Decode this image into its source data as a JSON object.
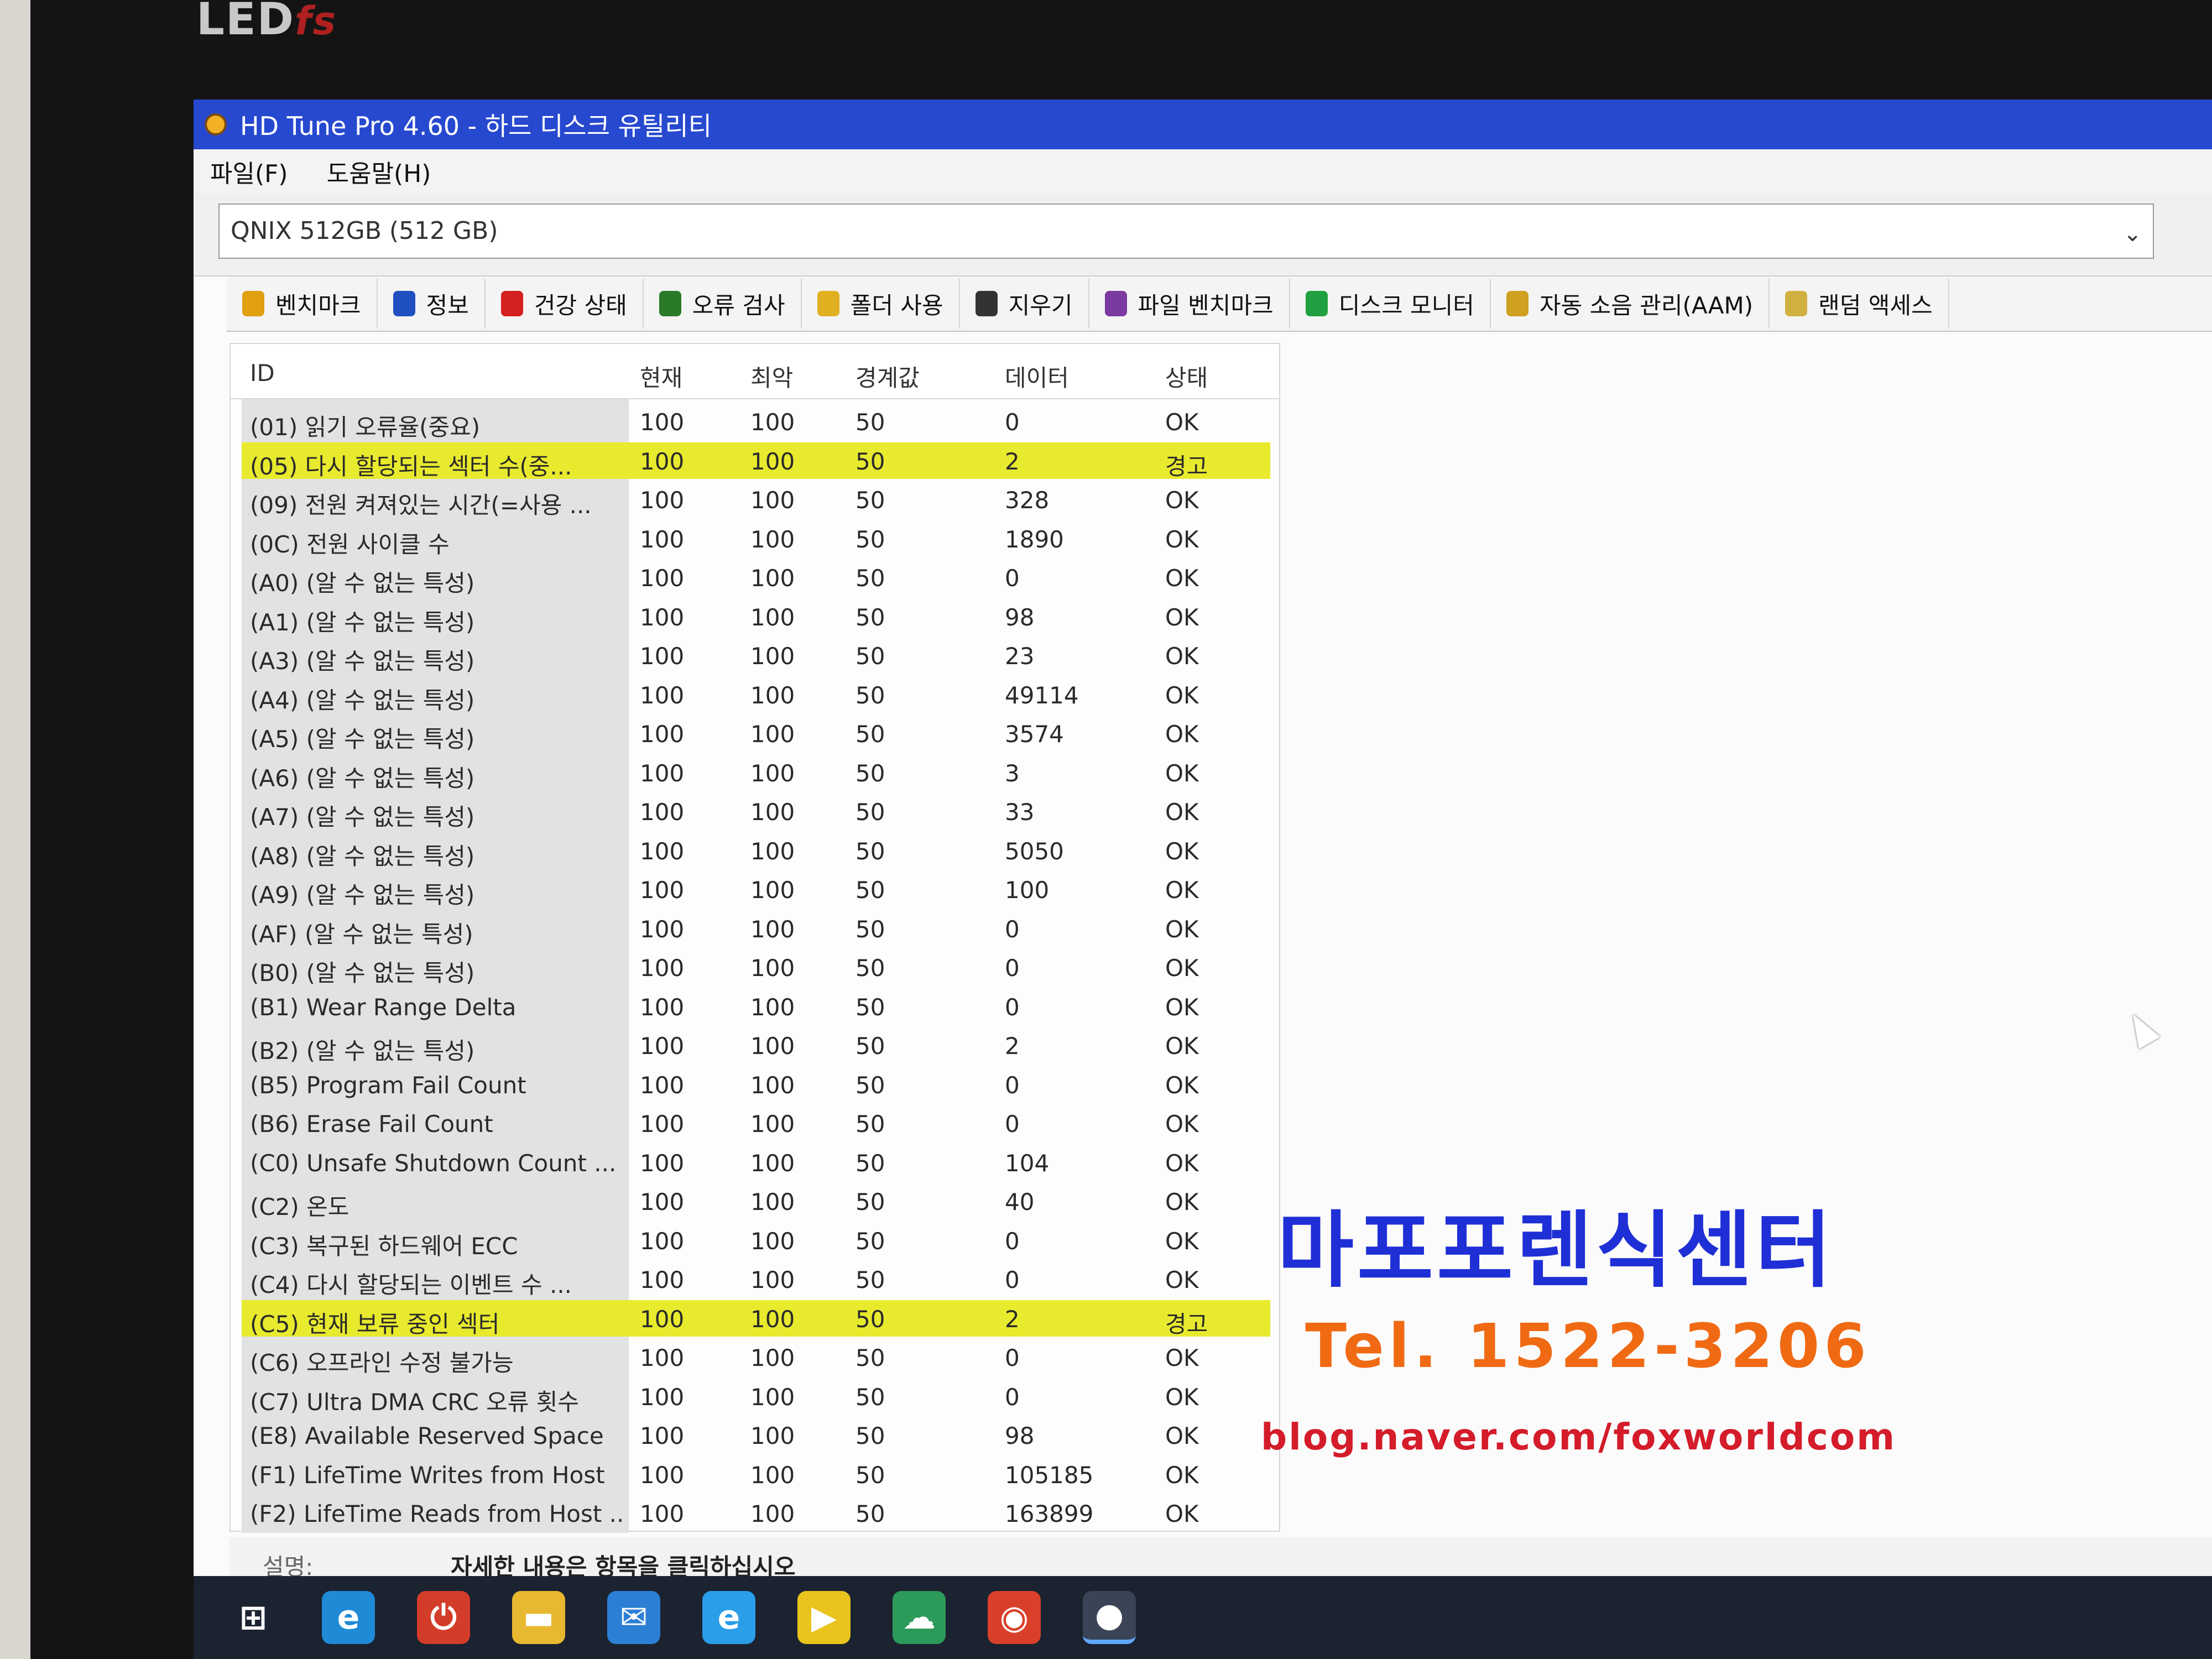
{
  "monitor": {
    "brand": "LED",
    "brand_suffix": "fs"
  },
  "window": {
    "title": "HD Tune Pro 4.60 - 하드 디스크 유틸리티"
  },
  "menu": {
    "file": "파일(F)",
    "help": "도움말(H)"
  },
  "drive": {
    "selected": "QNIX 512GB (512 GB)"
  },
  "tabs": [
    {
      "label": "벤치마크",
      "icon": "bulb-icon",
      "color": "#e0a010"
    },
    {
      "label": "정보",
      "icon": "info-icon",
      "color": "#2050c0"
    },
    {
      "label": "건강 상태",
      "icon": "health-cross-icon",
      "color": "#d42020"
    },
    {
      "label": "오류 검사",
      "icon": "magnifier-icon",
      "color": "#2a7a2a"
    },
    {
      "label": "폴더 사용",
      "icon": "folder-icon",
      "color": "#e0b020"
    },
    {
      "label": "지우기",
      "icon": "trash-icon",
      "color": "#333333"
    },
    {
      "label": "파일 벤치마크",
      "icon": "file-bench-icon",
      "color": "#7a3aa0"
    },
    {
      "label": "디스크 모니터",
      "icon": "monitor-chart-icon",
      "color": "#20a040"
    },
    {
      "label": "자동 소음 관리(AAM)",
      "icon": "speaker-icon",
      "color": "#d0a020"
    },
    {
      "label": "랜덤 액세스",
      "icon": "random-access-icon",
      "color": "#d0b040"
    }
  ],
  "table": {
    "headers": {
      "id": "ID",
      "current": "현재",
      "worst": "최악",
      "threshold": "경계값",
      "data": "데이터",
      "status": "상태"
    },
    "rows": [
      {
        "id": "(01) 읽기 오류율(중요)",
        "current": "100",
        "worst": "100",
        "threshold": "50",
        "data": "0",
        "status": "OK",
        "warning": false
      },
      {
        "id": "(05) 다시 할당되는 섹터 수(중...",
        "current": "100",
        "worst": "100",
        "threshold": "50",
        "data": "2",
        "status": "경고",
        "warning": true
      },
      {
        "id": "(09) 전원 켜져있는 시간(=사용 ...",
        "current": "100",
        "worst": "100",
        "threshold": "50",
        "data": "328",
        "status": "OK",
        "warning": false
      },
      {
        "id": "(0C) 전원 사이클 수",
        "current": "100",
        "worst": "100",
        "threshold": "50",
        "data": "1890",
        "status": "OK",
        "warning": false
      },
      {
        "id": "(A0) (알 수 없는 특성)",
        "current": "100",
        "worst": "100",
        "threshold": "50",
        "data": "0",
        "status": "OK",
        "warning": false
      },
      {
        "id": "(A1) (알 수 없는 특성)",
        "current": "100",
        "worst": "100",
        "threshold": "50",
        "data": "98",
        "status": "OK",
        "warning": false
      },
      {
        "id": "(A3) (알 수 없는 특성)",
        "current": "100",
        "worst": "100",
        "threshold": "50",
        "data": "23",
        "status": "OK",
        "warning": false
      },
      {
        "id": "(A4) (알 수 없는 특성)",
        "current": "100",
        "worst": "100",
        "threshold": "50",
        "data": "49114",
        "status": "OK",
        "warning": false
      },
      {
        "id": "(A5) (알 수 없는 특성)",
        "current": "100",
        "worst": "100",
        "threshold": "50",
        "data": "3574",
        "status": "OK",
        "warning": false
      },
      {
        "id": "(A6) (알 수 없는 특성)",
        "current": "100",
        "worst": "100",
        "threshold": "50",
        "data": "3",
        "status": "OK",
        "warning": false
      },
      {
        "id": "(A7) (알 수 없는 특성)",
        "current": "100",
        "worst": "100",
        "threshold": "50",
        "data": "33",
        "status": "OK",
        "warning": false
      },
      {
        "id": "(A8) (알 수 없는 특성)",
        "current": "100",
        "worst": "100",
        "threshold": "50",
        "data": "5050",
        "status": "OK",
        "warning": false
      },
      {
        "id": "(A9) (알 수 없는 특성)",
        "current": "100",
        "worst": "100",
        "threshold": "50",
        "data": "100",
        "status": "OK",
        "warning": false
      },
      {
        "id": "(AF) (알 수 없는 특성)",
        "current": "100",
        "worst": "100",
        "threshold": "50",
        "data": "0",
        "status": "OK",
        "warning": false
      },
      {
        "id": "(B0) (알 수 없는 특성)",
        "current": "100",
        "worst": "100",
        "threshold": "50",
        "data": "0",
        "status": "OK",
        "warning": false
      },
      {
        "id": "(B1) Wear Range Delta",
        "current": "100",
        "worst": "100",
        "threshold": "50",
        "data": "0",
        "status": "OK",
        "warning": false
      },
      {
        "id": "(B2) (알 수 없는 특성)",
        "current": "100",
        "worst": "100",
        "threshold": "50",
        "data": "2",
        "status": "OK",
        "warning": false
      },
      {
        "id": "(B5) Program Fail Count",
        "current": "100",
        "worst": "100",
        "threshold": "50",
        "data": "0",
        "status": "OK",
        "warning": false
      },
      {
        "id": "(B6) Erase Fail Count",
        "current": "100",
        "worst": "100",
        "threshold": "50",
        "data": "0",
        "status": "OK",
        "warning": false
      },
      {
        "id": "(C0) Unsafe Shutdown Count ...",
        "current": "100",
        "worst": "100",
        "threshold": "50",
        "data": "104",
        "status": "OK",
        "warning": false
      },
      {
        "id": "(C2) 온도",
        "current": "100",
        "worst": "100",
        "threshold": "50",
        "data": "40",
        "status": "OK",
        "warning": false
      },
      {
        "id": "(C3) 복구된 하드웨어 ECC",
        "current": "100",
        "worst": "100",
        "threshold": "50",
        "data": "0",
        "status": "OK",
        "warning": false
      },
      {
        "id": "(C4) 다시 할당되는 이벤트 수 ...",
        "current": "100",
        "worst": "100",
        "threshold": "50",
        "data": "0",
        "status": "OK",
        "warning": false
      },
      {
        "id": "(C5) 현재 보류 중인 섹터",
        "current": "100",
        "worst": "100",
        "threshold": "50",
        "data": "2",
        "status": "경고",
        "warning": true
      },
      {
        "id": "(C6) 오프라인 수정 불가능",
        "current": "100",
        "worst": "100",
        "threshold": "50",
        "data": "0",
        "status": "OK",
        "warning": false
      },
      {
        "id": "(C7) Ultra DMA CRC 오류 횟수",
        "current": "100",
        "worst": "100",
        "threshold": "50",
        "data": "0",
        "status": "OK",
        "warning": false
      },
      {
        "id": "(E8) Available Reserved Space",
        "current": "100",
        "worst": "100",
        "threshold": "50",
        "data": "98",
        "status": "OK",
        "warning": false
      },
      {
        "id": "(F1) LifeTime Writes from Host",
        "current": "100",
        "worst": "100",
        "threshold": "50",
        "data": "105185",
        "status": "OK",
        "warning": false
      },
      {
        "id": "(F2) LifeTime Reads from Host ...",
        "current": "100",
        "worst": "100",
        "threshold": "50",
        "data": "163899",
        "status": "OK",
        "warning": false
      }
    ]
  },
  "description": {
    "label": "설명:",
    "text": "자세한 내용은 항목을 클릭하십시오"
  },
  "watermark": {
    "name": "마포포렌식센터",
    "tel": "Tel. 1522-3206",
    "blog": "blog.naver.com/foxworldcom"
  },
  "taskbar": [
    {
      "icon": "windows-start-icon",
      "glyph": "⊞",
      "color": "#1b2230"
    },
    {
      "icon": "edge-icon",
      "glyph": "e",
      "color": "#1f8ad6"
    },
    {
      "icon": "power-app-icon",
      "glyph": "⏻",
      "color": "#d43c2a"
    },
    {
      "icon": "file-explorer-icon",
      "glyph": "▬",
      "color": "#e8b830"
    },
    {
      "icon": "mail-icon",
      "glyph": "✉",
      "color": "#2c7fd4"
    },
    {
      "icon": "internet-explorer-icon",
      "glyph": "e",
      "color": "#2a9ee8"
    },
    {
      "icon": "media-player-icon",
      "glyph": "▶",
      "color": "#e8c41c"
    },
    {
      "icon": "onedrive-icon",
      "glyph": "☁",
      "color": "#2c9a5a"
    },
    {
      "icon": "chrome-icon",
      "glyph": "◉",
      "color": "#d8402c"
    },
    {
      "icon": "hdtune-taskbar-icon",
      "glyph": "●",
      "color": "#3a4456"
    }
  ]
}
